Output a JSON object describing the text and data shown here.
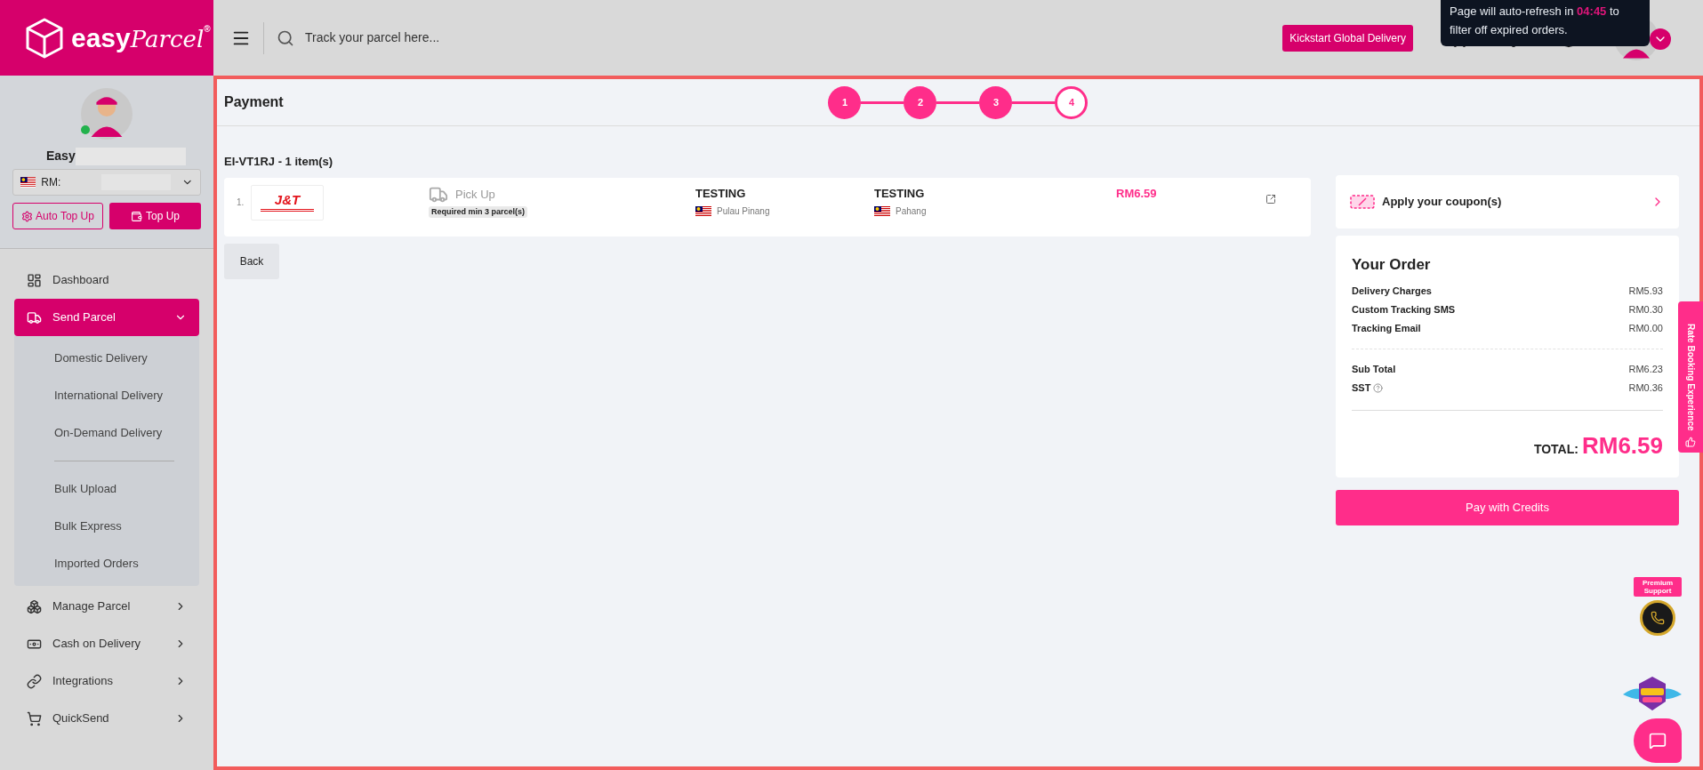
{
  "header": {
    "search_placeholder": "Track your parcel here...",
    "kickstart_button": "Kickstart Global Delivery"
  },
  "tooltip": {
    "text_before": "Page will auto-refresh in",
    "countdown": "04:45",
    "text_after": "to filter off expired orders."
  },
  "logo": {
    "word1": "easy",
    "word2": "Parcel",
    "mark": "®"
  },
  "sidebar": {
    "user_name": "Easy",
    "online": true,
    "wallet": "RM:",
    "auto_top_up": "Auto Top Up",
    "top_up": "Top Up",
    "items": [
      {
        "label": "Dashboard",
        "selected": false
      },
      {
        "label": "Send Parcel",
        "selected": true,
        "expanded": true,
        "children": [
          {
            "kind": "link",
            "label": "Domestic Delivery"
          },
          {
            "kind": "link",
            "label": "International Delivery"
          },
          {
            "kind": "link",
            "label": "On-Demand Delivery"
          },
          {
            "kind": "divider"
          },
          {
            "kind": "link",
            "label": "Bulk Upload"
          },
          {
            "kind": "link",
            "label": "Bulk Express"
          },
          {
            "kind": "link",
            "label": "Imported Orders"
          }
        ]
      },
      {
        "label": "Manage Parcel",
        "selected": false,
        "expanded": false
      },
      {
        "label": "Cash on Delivery",
        "selected": false,
        "expanded": false
      },
      {
        "label": "Integrations",
        "selected": false,
        "expanded": false
      },
      {
        "label": "QuickSend",
        "selected": false,
        "expanded": false
      }
    ]
  },
  "page_title": "Payment",
  "steps": [
    {
      "label": "1",
      "selected": false
    },
    {
      "label": "2",
      "selected": false
    },
    {
      "label": "3",
      "selected": false
    },
    {
      "label": "4",
      "selected": true
    }
  ],
  "order": {
    "heading": "EI-VT1RJ - 1 item(s)",
    "items": [
      {
        "index": "1.",
        "courier_logo": "J&T",
        "service": "Pick Up",
        "requirement": "Required min 3 parcel(s)",
        "sender": {
          "name": "TESTING",
          "state": "Pulau Pinang"
        },
        "receiver": {
          "name": "TESTING",
          "state": "Pahang"
        },
        "price": "RM6.59"
      }
    ]
  },
  "back_button": "Back",
  "coupon": "Apply your coupon(s)",
  "summary": {
    "title": "Your Order",
    "charges": [
      {
        "label": "Delivery Charges",
        "value": "RM5.93"
      },
      {
        "label": "Custom Tracking SMS",
        "value": "RM0.30"
      },
      {
        "label": "Tracking Email",
        "value": "RM0.00"
      }
    ],
    "totals": [
      {
        "label": "Sub Total",
        "value": "RM6.23",
        "help": false
      },
      {
        "label": "SST",
        "value": "RM0.36",
        "help": true
      }
    ],
    "total_label": "TOTAL:",
    "total_value": "RM6.59"
  },
  "pay_button": "Pay with Credits",
  "rate_tab": "Rate Booking Experience",
  "premium_support": "Premium Support"
}
